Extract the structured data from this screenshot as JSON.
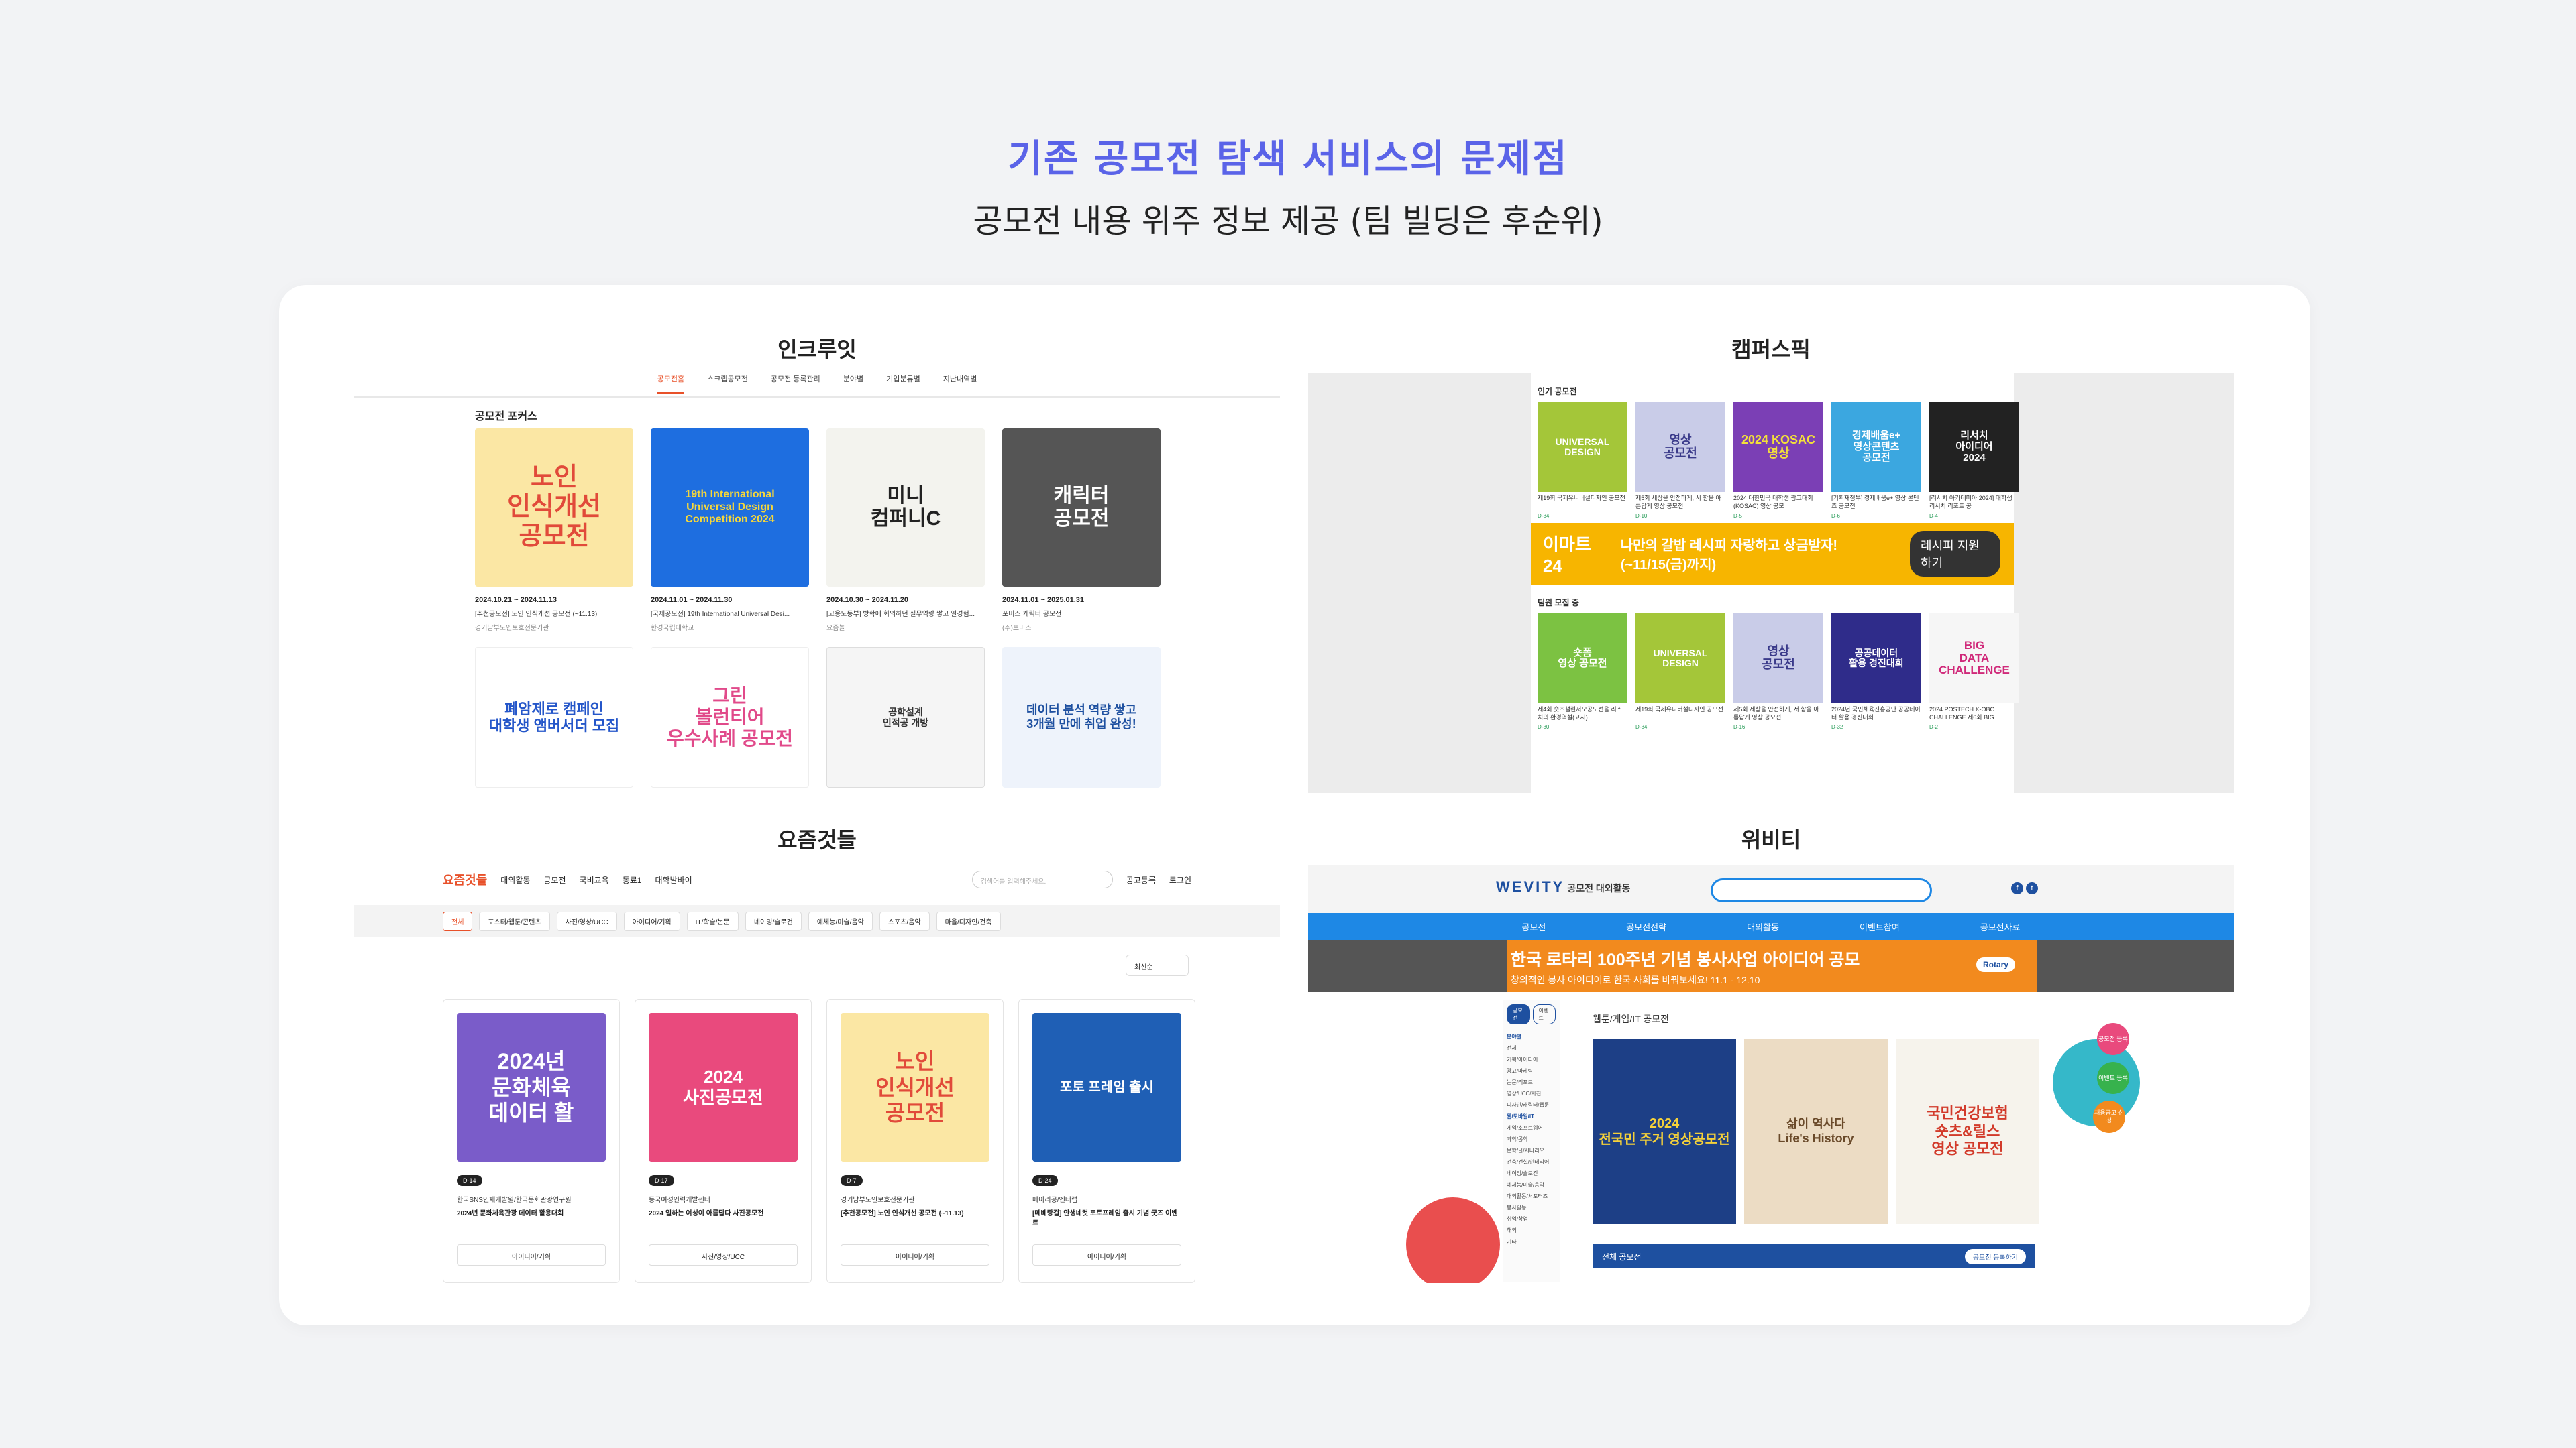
{
  "header": {
    "title": "기존 공모전 탐색 서비스의 문제점",
    "subtitle": "공모전 내용 위주 정보 제공 (팀 빌딩은 후순위)"
  },
  "sections": {
    "incruit": "인크루잇",
    "campuspick": "캠퍼스픽",
    "yozm": "요즘것들",
    "wevity": "위비티"
  },
  "incruit": {
    "nav": [
      "공모전홈",
      "스크랩공모전",
      "공모전 등록관리",
      "분야별",
      "기업분류별",
      "지난내역별"
    ],
    "focus_title": "공모전 포커스",
    "cards": [
      {
        "thumb": "노인\n인식개선\n공모전",
        "date": "2024.10.21 ~ 2024.11.13",
        "name": "[추천공모전] 노인 인식개선 공모전 (~11.13)",
        "org": "경기남부노인보호전문기관"
      },
      {
        "thumb": "19th International\nUniversal Design\nCompetition 2024",
        "date": "2024.11.01 ~ 2024.11.30",
        "name": "[국제공모전] 19th International Universal Desi...",
        "org": "한경국립대학교"
      },
      {
        "thumb": "미니\n컴퍼니C",
        "date": "2024.10.30 ~ 2024.11.20",
        "name": "[고용노동부] 방학에 회의하던 실무역량 쌓고 일경험...",
        "org": "요즘놀"
      },
      {
        "thumb": "캐릭터\n공모전",
        "date": "2024.11.01 ~ 2025.01.31",
        "name": "포미스 캐릭터 공모전",
        "org": "(주)포미스"
      },
      {
        "thumb": "폐암제로 캠페인\n대학생 앰버서더 모집",
        "date": "",
        "name": "",
        "org": ""
      },
      {
        "thumb": "그린\n볼런티어\n우수사례 공모전",
        "date": "",
        "name": "",
        "org": ""
      },
      {
        "thumb": "공학설계\n인적공 개방",
        "date": "",
        "name": "",
        "org": ""
      },
      {
        "thumb": "데이터 분석 역량 쌓고\n3개월 만에 취업 완성!",
        "date": "",
        "name": "",
        "org": ""
      }
    ]
  },
  "campuspick": {
    "popular_title": "인기 공모전",
    "popular": [
      {
        "thumb": "UNIVERSAL\nDESIGN",
        "title": "제19회 국제유니버설디자인 공모전",
        "meta": "D-34"
      },
      {
        "thumb": "영상\n공모전",
        "title": "제5회 세상을 안전하게, 서 함을 아름답게 영상 공모전",
        "meta": "D-10"
      },
      {
        "thumb": "2024 KOSAC\n영상",
        "title": "2024 대한민국 대학생 광고대회 (KOSAC) 영상 공모",
        "meta": "D-5"
      },
      {
        "thumb": "경제배움e+\n영상콘텐츠\n공모전",
        "title": "[기획재정부] 경제배움e+ 영상 콘텐츠 공모전",
        "meta": "D-6"
      },
      {
        "thumb": "리서치\n아이디어\n2024",
        "title": "[리서치 아카데미아 2024] 대학생 리서치 리포트 공",
        "meta": "D-4"
      }
    ],
    "banner": {
      "brand": "이마트24",
      "text": "나만의 갈밥 레시피 자랑하고 상금받자! (~11/15(금)까지)",
      "cta": "레시피 지원하기"
    },
    "team_title": "팀원 모집 중",
    "team": [
      {
        "thumb": "숏폼\n영상 공모전",
        "title": "제4회 숏츠챌린저모공모전을 리스치의 환경역설(고시)",
        "meta": "D-30"
      },
      {
        "thumb": "UNIVERSAL\nDESIGN",
        "title": "제19회 국제유니버설디자인 공모전",
        "meta": "D-34"
      },
      {
        "thumb": "영상\n공모전",
        "title": "제5회 세상을 안전하게, 서 함을 아름답게 영상 공모전",
        "meta": "D-16"
      },
      {
        "thumb": "공공데이터\n활용 경진대회",
        "title": "2024년 국민체육진흥공단 공공데이터 활용 경진대회",
        "meta": "D-32"
      },
      {
        "thumb": "BIG\nDATA\nCHALLENGE",
        "title": "2024 POSTECH X-OBC CHALLENGE 제6회 BIG...",
        "meta": "D-2"
      }
    ]
  },
  "yozm": {
    "logo": "요즘것들",
    "nav": [
      "대외활동",
      "공모전",
      "국비교육",
      "동료1",
      "대학발바이"
    ],
    "search_placeholder": "검색어를 입력해주세요.",
    "links": [
      "공고등록",
      "로그인"
    ],
    "categories": [
      "전체",
      "포스터/웹툰/콘텐츠",
      "사진/영상/UCC",
      "아이디어/기획",
      "IT/학술/논문",
      "네이밍/슬로건",
      "예체능/미술/음악",
      "스포츠/음악",
      "마을/디자인/건축"
    ],
    "sort": "최신순",
    "cards": [
      {
        "thumb": "2024년\n문화체육\n데이터 활",
        "dday": "D-14",
        "org": "한국SNS인재개발원/한국문화관광연구원",
        "name": "2024년 문화체육관광 데이터 활용대회",
        "category": "아이디어/기획"
      },
      {
        "thumb": "2024\n사진공모전",
        "dday": "D-17",
        "org": "동국여성인력개발센터",
        "name": "2024 일하는 여성이 아름답다 사진공모전",
        "category": "사진/영상/UCC"
      },
      {
        "thumb": "노인\n인식개선\n공모전",
        "dday": "D-7",
        "org": "경기남부노인보호전문기관",
        "name": "[추천공모전] 노인 인식개선 공모전 (~11.13)",
        "category": "아이디어/기획"
      },
      {
        "thumb": "포토 프레임 출시",
        "dday": "D-24",
        "org": "메아리공/엔터랩",
        "name": "[메베랑걸] 안생네컷 포토프레임 출시 기념 굿즈 이벤트",
        "category": "아이디어/기획"
      }
    ]
  },
  "wevity": {
    "logo": "WEVITY",
    "logo_sub": "공모전 대외활동",
    "nav": [
      "공모전",
      "공모전전략",
      "대외활동",
      "이벤트참여",
      "공모전자료"
    ],
    "banner_title": "한국 로타리 100주년 기념 봉사사업 아이디어 공모",
    "banner_sub": "창의적인 봉사 아이디어로 한국 사회를 바꿔보세요!  11.1 - 12.10",
    "banner_badge": "Rotary",
    "side_tabs": [
      "공모전",
      "이벤트"
    ],
    "side_items": [
      "분야별",
      "전체",
      "기획/아이디어",
      "광고/마케팅",
      "논문/리포트",
      "영상/UCC/사진",
      "디자인/캐릭터/웹툰",
      "웹/모바일/IT",
      "게임/소프트웨어",
      "과학/공학",
      "문학/글/시나리오",
      "건축/건설/인테리어",
      "네이밍/슬로건",
      "예체능/미술/음악",
      "대외활동/서포터즈",
      "봉사활동",
      "취업/창업",
      "해외",
      "기타"
    ],
    "main_title": "웹툰/게임/IT 공모전",
    "cards": [
      "2024\n전국민 주거 영상공모전",
      "삶이 역사다\nLife's History",
      "국민건강보험\n숏츠&릴스\n영상 공모전"
    ],
    "bar_label": "전체 공모전",
    "bar_btn": "공모전 등록하기",
    "badges": [
      "공모전 등록",
      "이벤트 등록",
      "채용공고 신청"
    ]
  }
}
